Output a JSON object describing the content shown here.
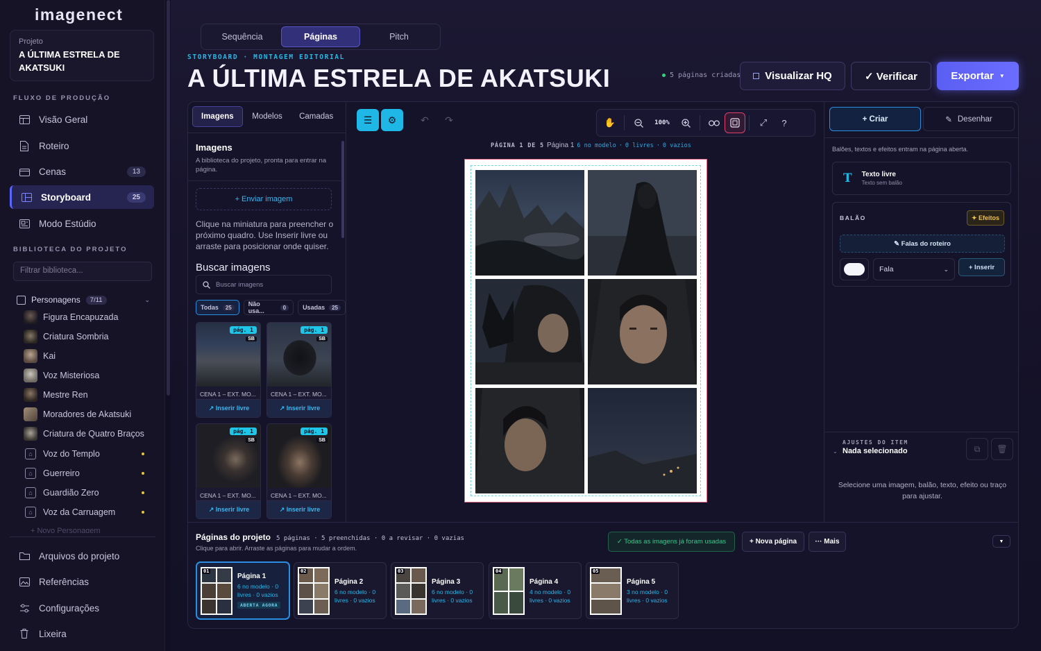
{
  "app": {
    "logo": "imagenect"
  },
  "project": {
    "label": "Projeto",
    "title": "A ÚLTIMA ESTRELA DE AKATSUKI"
  },
  "sidebar": {
    "flow_label": "FLUXO DE PRODUÇÃO",
    "items": [
      {
        "label": "Visão Geral",
        "icon": "dashboard-icon"
      },
      {
        "label": "Roteiro",
        "icon": "script-icon"
      },
      {
        "label": "Cenas",
        "icon": "scenes-icon",
        "count": "13"
      },
      {
        "label": "Storyboard",
        "icon": "storyboard-icon",
        "count": "25",
        "active": true
      },
      {
        "label": "Modo Estúdio",
        "icon": "studio-icon"
      }
    ],
    "library_label": "BIBLIOTECA DO PROJETO",
    "filter_placeholder": "Filtrar biblioteca...",
    "characters_label": "Personagens",
    "characters_count": "7/11",
    "characters": [
      {
        "name": "Figura Encapuzada"
      },
      {
        "name": "Criatura Sombria"
      },
      {
        "name": "Kai"
      },
      {
        "name": "Voz Misteriosa"
      },
      {
        "name": "Mestre Ren"
      },
      {
        "name": "Moradores de Akatsuki"
      },
      {
        "name": "Criatura de Quatro Braços"
      },
      {
        "name": "Voz do Templo"
      },
      {
        "name": "Guerreiro"
      },
      {
        "name": "Guardião Zero"
      },
      {
        "name": "Voz da Carruagem"
      }
    ],
    "new_character": "+ Novo Personagem",
    "bottom_items": [
      {
        "label": "Arquivos do projeto",
        "icon": "folder-icon"
      },
      {
        "label": "Referências",
        "icon": "image-icon"
      },
      {
        "label": "Configurações",
        "icon": "settings-icon"
      },
      {
        "label": "Lixeira",
        "icon": "trash-icon"
      }
    ]
  },
  "top_tabs": [
    "Sequência",
    "Páginas",
    "Pitch"
  ],
  "active_top_tab": "Páginas",
  "breadcrumb": "STORYBOARD · MONTAGEM EDITORIAL",
  "page_title": "A ÚLTIMA ESTRELA DE AKATSUKI",
  "pages_created": "5 páginas criadas",
  "actions": {
    "hq": "Visualizar HQ",
    "verify": "✓ Verificar",
    "export": "Exportar"
  },
  "library": {
    "tabs": [
      "Imagens",
      "Modelos",
      "Camadas"
    ],
    "heading": "Imagens",
    "subheading": "A biblioteca do projeto, pronta para entrar na página.",
    "upload": "+ Enviar imagem",
    "help": "Clique na miniatura para preencher o próximo quadro. Use Inserir livre ou arraste para posicionar onde quiser.",
    "search_title": "Buscar imagens",
    "search_placeholder": "Buscar imagens",
    "filters": [
      {
        "label": "Todas",
        "count": "25"
      },
      {
        "label": "Não usa...",
        "count": "0"
      },
      {
        "label": "Usadas",
        "count": "25"
      }
    ],
    "thumbs": [
      {
        "page": "pág. 1",
        "tag": "SB",
        "caption": "CENA 1 – EXT. MO...",
        "action": "↗ Inserir livre"
      },
      {
        "page": "pág. 1",
        "tag": "SB",
        "caption": "CENA 1 – EXT. MO...",
        "action": "↗ Inserir livre"
      },
      {
        "page": "pág. 1",
        "tag": "SB",
        "caption": "CENA 1 – EXT. MO...",
        "action": "↗ Inserir livre"
      },
      {
        "page": "pág. 1",
        "tag": "SB",
        "caption": "CENA 1 – EXT. MO...",
        "action": "↗ Inserir livre"
      }
    ]
  },
  "canvas": {
    "zoom": "100%",
    "page_of": "PÁGINA 1 DE 5",
    "page_name": "Página 1",
    "meta": [
      "6 no modelo",
      "·",
      "0 livres",
      "·",
      "0 vazios"
    ]
  },
  "tools": {
    "create": "+ Criar",
    "draw": "Desenhar",
    "note": "Balões, textos e efeitos entram na página aberta.",
    "free_text_title": "Texto livre",
    "free_text_sub": "Texto sem balão",
    "balloon_label": "BALÃO",
    "effects": "✦ Efeitos",
    "script_lines": "✎ Falas do roteiro",
    "balloon_type": "Fala",
    "insert": "+ Inserir"
  },
  "adjust": {
    "label": "AJUSTES DO ITEM",
    "selection": "Nada selecionado",
    "message": "Selecione uma imagem, balão, texto, efeito ou traço para ajustar."
  },
  "pages_panel": {
    "title": "Páginas do projeto",
    "stats": "5 páginas · 5 preenchidas · 0 a revisar · 0 vazias",
    "hint": "Clique para abrir. Arraste as páginas para mudar a ordem.",
    "all_used": "✓ Todas as imagens já foram usadas",
    "new_page": "+ Nova página",
    "more": "··· Mais",
    "pages": [
      {
        "num": "01",
        "title": "Página 1",
        "detail": "6 no modelo · 0 livres · 0 vazios",
        "badge": "ABERTA AGORA",
        "active": true
      },
      {
        "num": "02",
        "title": "Página 2",
        "detail": "6 no modelo · 0 livres · 0 vazios"
      },
      {
        "num": "03",
        "title": "Página 3",
        "detail": "6 no modelo · 0 livres · 0 vazios"
      },
      {
        "num": "04",
        "title": "Página 4",
        "detail": "4 no modelo · 0 livres · 0 vazios"
      },
      {
        "num": "05",
        "title": "Página 5",
        "detail": "3 no modelo · 0 livres · 0 vazios"
      }
    ]
  },
  "colors": {
    "accent": "#6366f1",
    "cyan": "#1fb8e6",
    "bg": "#120f22"
  }
}
